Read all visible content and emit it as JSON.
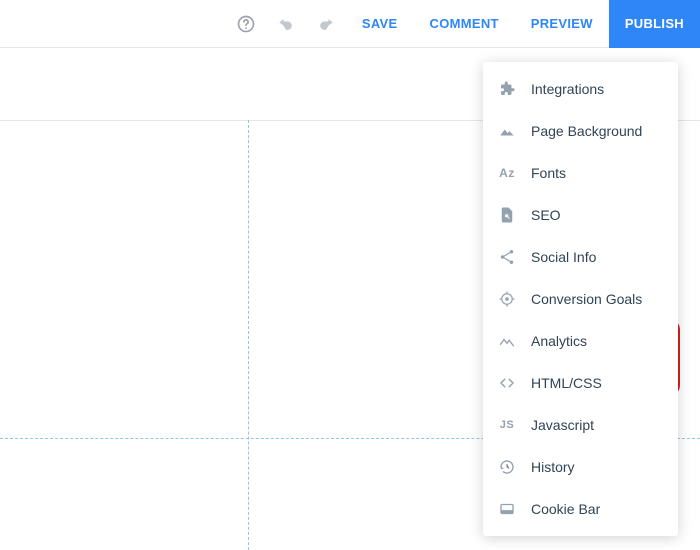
{
  "toolbar": {
    "save": "SAVE",
    "comment": "COMMENT",
    "preview": "PREVIEW",
    "publish": "PUBLISH"
  },
  "menu": {
    "integrations": "Integrations",
    "page_background": "Page Background",
    "fonts": "Fonts",
    "seo": "SEO",
    "social_info": "Social Info",
    "conversion_goals": "Conversion Goals",
    "analytics": "Analytics",
    "html_css": "HTML/CSS",
    "javascript": "Javascript",
    "history": "History",
    "cookie_bar": "Cookie Bar"
  },
  "icon_text": {
    "az": "Az",
    "js": "JS"
  }
}
